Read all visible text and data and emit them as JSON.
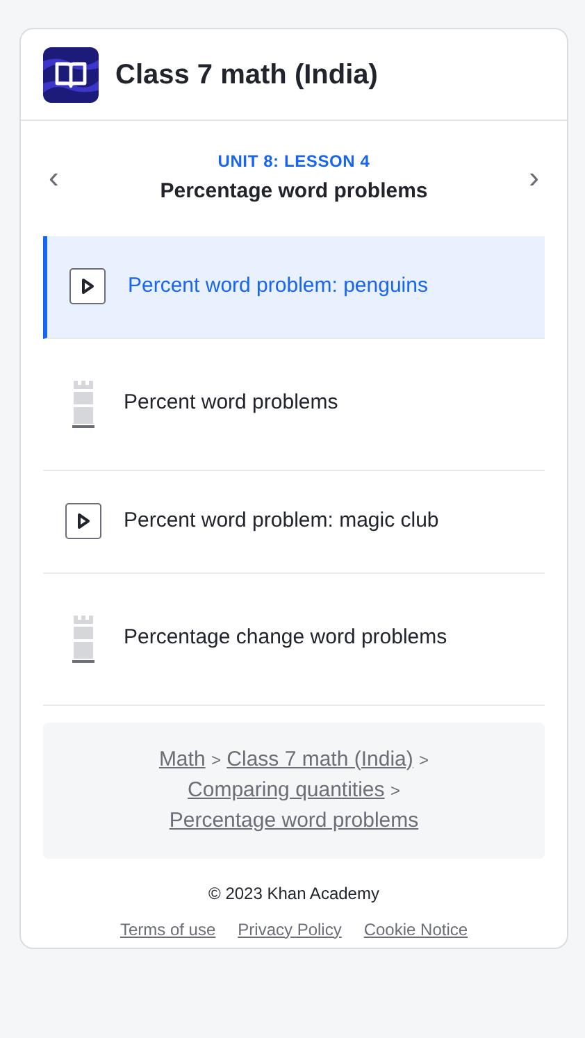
{
  "header": {
    "title": "Class 7 math (India)"
  },
  "lesson_nav": {
    "prev": "‹",
    "next": "›",
    "eyebrow": "UNIT 8: LESSON 4",
    "title": "Percentage word problems"
  },
  "items": [
    {
      "kind": "video",
      "label": "Percent word problem: penguins",
      "selected": true
    },
    {
      "kind": "exercise",
      "label": "Percent word problems",
      "selected": false
    },
    {
      "kind": "video",
      "label": "Percent word problem: magic club",
      "selected": false
    },
    {
      "kind": "exercise",
      "label": "Percentage change word problems",
      "selected": false
    }
  ],
  "breadcrumbs": [
    {
      "kind": "link",
      "text": "Math"
    },
    {
      "kind": "separator",
      "text": ">"
    },
    {
      "kind": "link",
      "text": "Class 7 math (India)"
    },
    {
      "kind": "separator",
      "text": ">"
    },
    {
      "kind": "link",
      "text": "Comparing quantities"
    },
    {
      "kind": "separator",
      "text": ">"
    },
    {
      "kind": "link",
      "text": "Percentage word problems"
    }
  ],
  "footer": {
    "copyright": "© 2023 Khan Academy",
    "links": [
      "Terms of use",
      "Privacy Policy",
      "Cookie Notice"
    ]
  }
}
